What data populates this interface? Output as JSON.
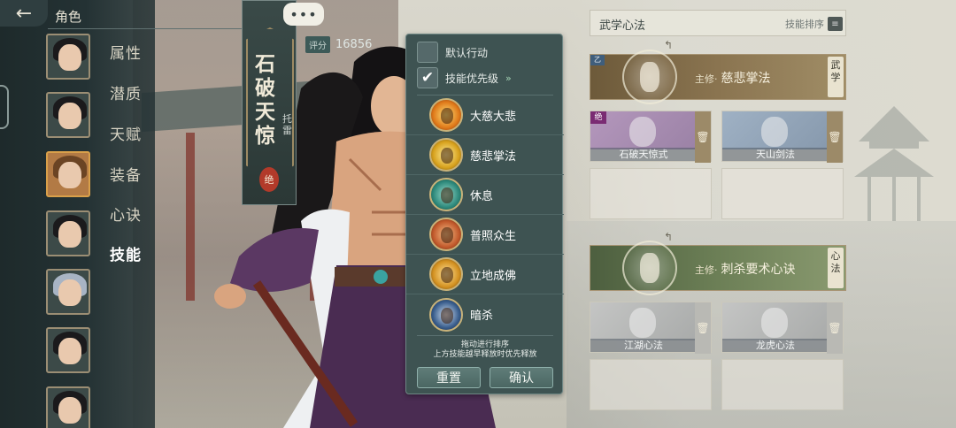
{
  "header": {
    "back_icon": "←",
    "title": "角色"
  },
  "sidebar": {
    "items": [
      {
        "label": "属性",
        "active": false
      },
      {
        "label": "潜质",
        "active": false
      },
      {
        "label": "天赋",
        "active": false
      },
      {
        "label": "装备",
        "active": false
      },
      {
        "label": "心诀",
        "active": false
      },
      {
        "label": "技能",
        "active": true
      }
    ],
    "portraits": [
      "portrait-1",
      "portrait-2",
      "portrait-3",
      "portrait-4",
      "portrait-5",
      "portrait-6",
      "portrait-7"
    ]
  },
  "character": {
    "name": "石破天惊",
    "sub_name": "托雷",
    "seal": "绝",
    "chat": "•••",
    "score_label": "评分",
    "score": "16856"
  },
  "skill_popup": {
    "default_action_label": "默认行动",
    "default_action_checked": false,
    "priority_label": "技能优先级",
    "priority_checked": true,
    "priority_arrow": "»",
    "skills": [
      {
        "name": "大慈大悲",
        "color": "#e07a1a"
      },
      {
        "name": "慈悲掌法",
        "color": "#d8a21e"
      },
      {
        "name": "休息",
        "color": "#2f8a7c"
      },
      {
        "name": "普照众生",
        "color": "#c25a2c"
      },
      {
        "name": "立地成佛",
        "color": "#d49222"
      },
      {
        "name": "暗杀",
        "color": "#3b5f8e"
      }
    ],
    "hint_line1": "拖动进行排序",
    "hint_line2": "上方技能越早释放时优先释放",
    "reset_label": "重置",
    "confirm_label": "确认"
  },
  "right_panel": {
    "title": "武学心法",
    "sort_label": "技能排序",
    "sort_icon": "≡",
    "martial": {
      "prefix": "主修·",
      "name": "慈悲掌法",
      "tag": "武学",
      "corner": "乙",
      "slots": [
        {
          "name": "石破天惊式",
          "rank": "绝",
          "color": "#a98ab2"
        },
        {
          "name": "天山剑法",
          "rank": "",
          "color": "#8fa2b5"
        }
      ]
    },
    "mind": {
      "prefix": "主修·",
      "name": "刺杀要术心诀",
      "tag": "心法",
      "slots": [
        {
          "name": "江湖心法",
          "color": "#b8b9b8"
        },
        {
          "name": "龙虎心法",
          "color": "#b8b9b8"
        }
      ]
    },
    "trash_icon": "🗑"
  }
}
